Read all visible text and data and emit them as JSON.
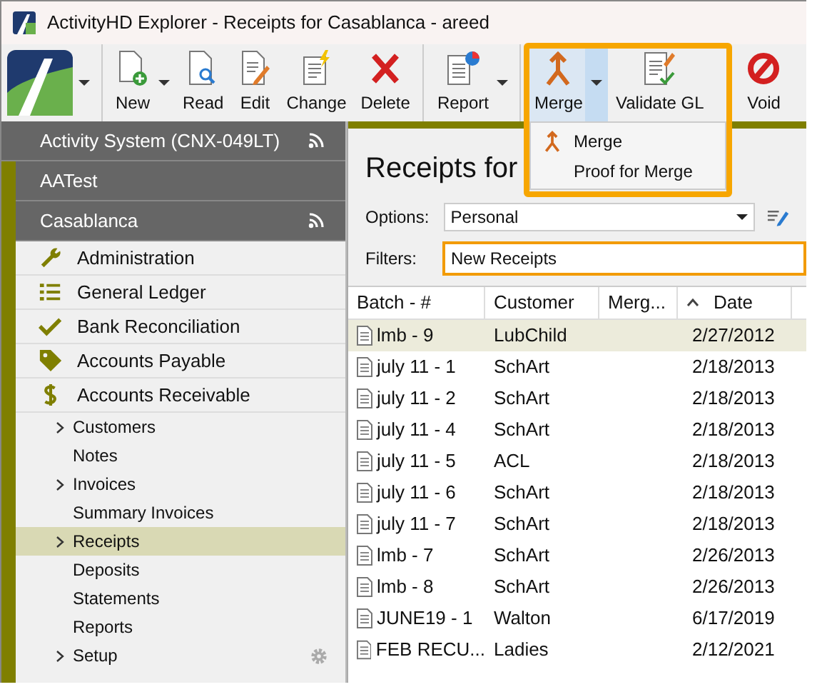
{
  "window": {
    "title": "ActivityHD Explorer - Receipts for Casablanca - areed"
  },
  "toolbar": [
    {
      "label": "New",
      "dropdown": true,
      "pressed": false
    },
    {
      "label": "Read",
      "dropdown": false,
      "pressed": false
    },
    {
      "label": "Edit",
      "dropdown": false,
      "pressed": false
    },
    {
      "label": "Change",
      "dropdown": false,
      "pressed": false
    },
    {
      "label": "Delete",
      "dropdown": false,
      "pressed": false
    },
    {
      "label": "Report",
      "dropdown": true,
      "pressed": false
    },
    {
      "label": "Merge",
      "dropdown": true,
      "pressed": true
    },
    {
      "label": "Validate GL",
      "dropdown": false,
      "pressed": false
    },
    {
      "label": "Void",
      "dropdown": false,
      "pressed": false
    }
  ],
  "merge_menu": [
    {
      "label": "Merge"
    },
    {
      "label": "Proof for Merge"
    }
  ],
  "sidebar": {
    "items": [
      {
        "kind": "section",
        "label": "Activity System (CNX-049LT)",
        "feed": true
      },
      {
        "kind": "section",
        "label": "AATest",
        "feed": false
      },
      {
        "kind": "section",
        "label": "Casablanca",
        "feed": true
      },
      {
        "kind": "module",
        "label": "Administration"
      },
      {
        "kind": "module",
        "label": "General Ledger"
      },
      {
        "kind": "module",
        "label": "Bank Reconciliation"
      },
      {
        "kind": "module",
        "label": "Accounts Payable"
      },
      {
        "kind": "module",
        "label": "Accounts Receivable",
        "children": [
          {
            "label": "Customers",
            "expandable": true,
            "selected": false,
            "settings": false
          },
          {
            "label": "Notes",
            "expandable": false,
            "selected": false,
            "settings": false
          },
          {
            "label": "Invoices",
            "expandable": true,
            "selected": false,
            "settings": false
          },
          {
            "label": "Summary Invoices",
            "expandable": false,
            "selected": false,
            "settings": false
          },
          {
            "label": "Receipts",
            "expandable": true,
            "selected": true,
            "settings": false
          },
          {
            "label": "Deposits",
            "expandable": false,
            "selected": false,
            "settings": false
          },
          {
            "label": "Statements",
            "expandable": false,
            "selected": false,
            "settings": false
          },
          {
            "label": "Reports",
            "expandable": false,
            "selected": false,
            "settings": false
          },
          {
            "label": "Setup",
            "expandable": true,
            "selected": false,
            "settings": true
          }
        ]
      }
    ]
  },
  "content": {
    "heading": "Receipts for",
    "options": {
      "label": "Options:",
      "value": "Personal"
    },
    "filters": {
      "label": "Filters:",
      "value": "New Receipts",
      "focused": true
    },
    "table": {
      "columns": [
        {
          "label": "Batch - #",
          "sorted": false
        },
        {
          "label": "Customer",
          "sorted": false
        },
        {
          "label": "Merg...",
          "sorted": false
        },
        {
          "label": "Date",
          "sorted": true
        }
      ],
      "rows": [
        {
          "cells": [
            "lmb - 9",
            "LubChild",
            "",
            "2/27/2012"
          ],
          "selected": true
        },
        {
          "cells": [
            "july 11 - 1",
            "SchArt",
            "",
            "2/18/2013"
          ],
          "selected": false
        },
        {
          "cells": [
            "july 11 - 2",
            "SchArt",
            "",
            "2/18/2013"
          ],
          "selected": false
        },
        {
          "cells": [
            "july 11 - 4",
            "SchArt",
            "",
            "2/18/2013"
          ],
          "selected": false
        },
        {
          "cells": [
            "july 11 - 5",
            "ACL",
            "",
            "2/18/2013"
          ],
          "selected": false
        },
        {
          "cells": [
            "july 11 - 6",
            "SchArt",
            "",
            "2/18/2013"
          ],
          "selected": false
        },
        {
          "cells": [
            "july 11 - 7",
            "SchArt",
            "",
            "2/18/2013"
          ],
          "selected": false
        },
        {
          "cells": [
            "lmb - 7",
            "SchArt",
            "",
            "2/26/2013"
          ],
          "selected": false
        },
        {
          "cells": [
            "lmb - 8",
            "SchArt",
            "",
            "2/26/2013"
          ],
          "selected": false
        },
        {
          "cells": [
            "JUNE19 - 1",
            "Walton",
            "",
            "6/17/2019"
          ],
          "selected": false
        },
        {
          "cells": [
            "FEB RECU...",
            "Ladies",
            "",
            "2/12/2021"
          ],
          "selected": false
        }
      ]
    }
  }
}
